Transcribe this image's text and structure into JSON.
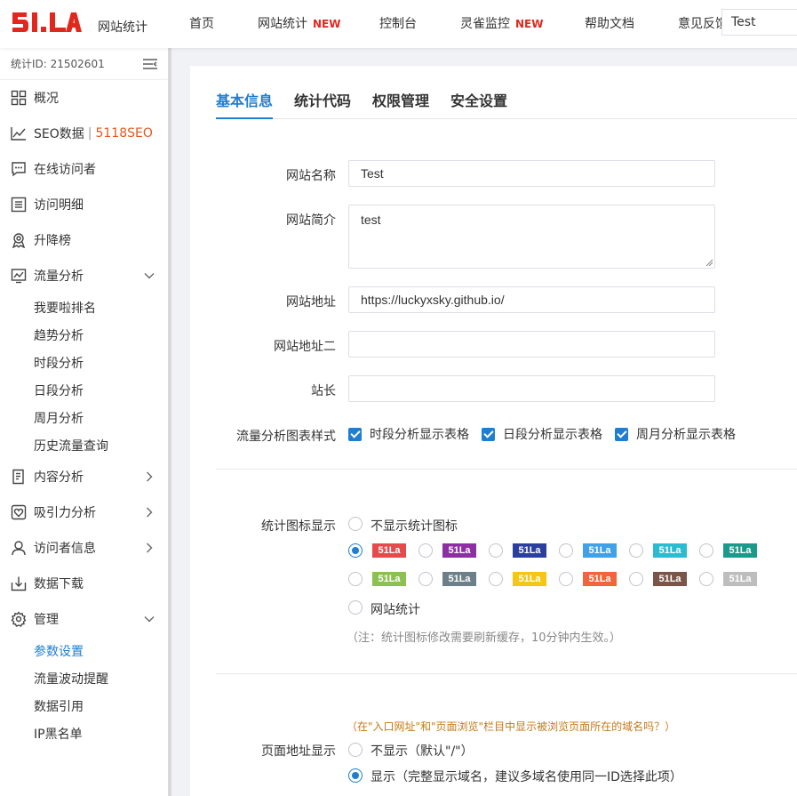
{
  "header": {
    "logo_alt": "51.LA",
    "logo_caption": "网站统计",
    "nav": [
      {
        "label": "首页",
        "new": ""
      },
      {
        "label": "网站统计",
        "new": "NEW"
      },
      {
        "label": "控制台",
        "new": ""
      },
      {
        "label": "灵雀监控",
        "new": "NEW"
      },
      {
        "label": "帮助文档",
        "new": ""
      },
      {
        "label": "意见反馈",
        "new": ""
      }
    ],
    "site_select": "Test"
  },
  "sidebar": {
    "site_id": "统计ID: 21502601",
    "menu": {
      "overview": "概况",
      "seo": "SEO数据",
      "seo_sep": "|",
      "seo_tag": "5118SEO",
      "online": "在线访问者",
      "visits": "访问明细",
      "ranking": "升降榜",
      "traffic": "流量分析",
      "content": "内容分析",
      "attraction": "吸引力分析",
      "visitor": "访问者信息",
      "download": "数据下载",
      "manage": "管理"
    },
    "traffic_sub": [
      "我要啦排名",
      "趋势分析",
      "时段分析",
      "日段分析",
      "周月分析",
      "历史流量查询"
    ],
    "manage_sub": [
      "参数设置",
      "流量波动提醒",
      "数据引用",
      "IP黑名单"
    ]
  },
  "tabs": [
    "基本信息",
    "统计代码",
    "权限管理",
    "安全设置"
  ],
  "form": {
    "name_label": "网站名称",
    "name_value": "Test",
    "desc_label": "网站简介",
    "desc_value": "test",
    "url_label": "网站地址",
    "url_value": "https://luckyxsky.github.io/",
    "url2_label": "网站地址二",
    "url2_value": "",
    "owner_label": "站长",
    "owner_value": "",
    "chart_style_label": "流量分析图表样式",
    "chart_options": [
      "时段分析显示表格",
      "日段分析显示表格",
      "周月分析显示表格"
    ],
    "icon_label": "统计图标显示",
    "icon_none": "不显示统计图标",
    "icon_text_option": "网站统计",
    "icon_badge_text": "51La",
    "icon_note": "（注：统计图标修改需要刷新缓存，10分钟内生效。）",
    "page_url_hint": "（在\"入口网址\"和\"页面浏览\"栏目中显示被浏览页面所在的域名吗？）",
    "page_url_label": "页面地址显示",
    "page_url_hide": "不显示（默认\"/\"）",
    "page_url_show": "显示（完整显示域名，建议多域名使用同一ID选择此项）"
  },
  "colors": {
    "accent": "#1f7ed0",
    "badges_row1": [
      "#e64a4a",
      "#8e2ea3",
      "#2b3f9e",
      "#3fa1e8",
      "#2bbcd2",
      "#1a9a8a"
    ],
    "badges_row2": [
      "#8cc152",
      "#6d7f88",
      "#f5c518",
      "#f2643b",
      "#7a5548",
      "#bdbdbd"
    ]
  }
}
